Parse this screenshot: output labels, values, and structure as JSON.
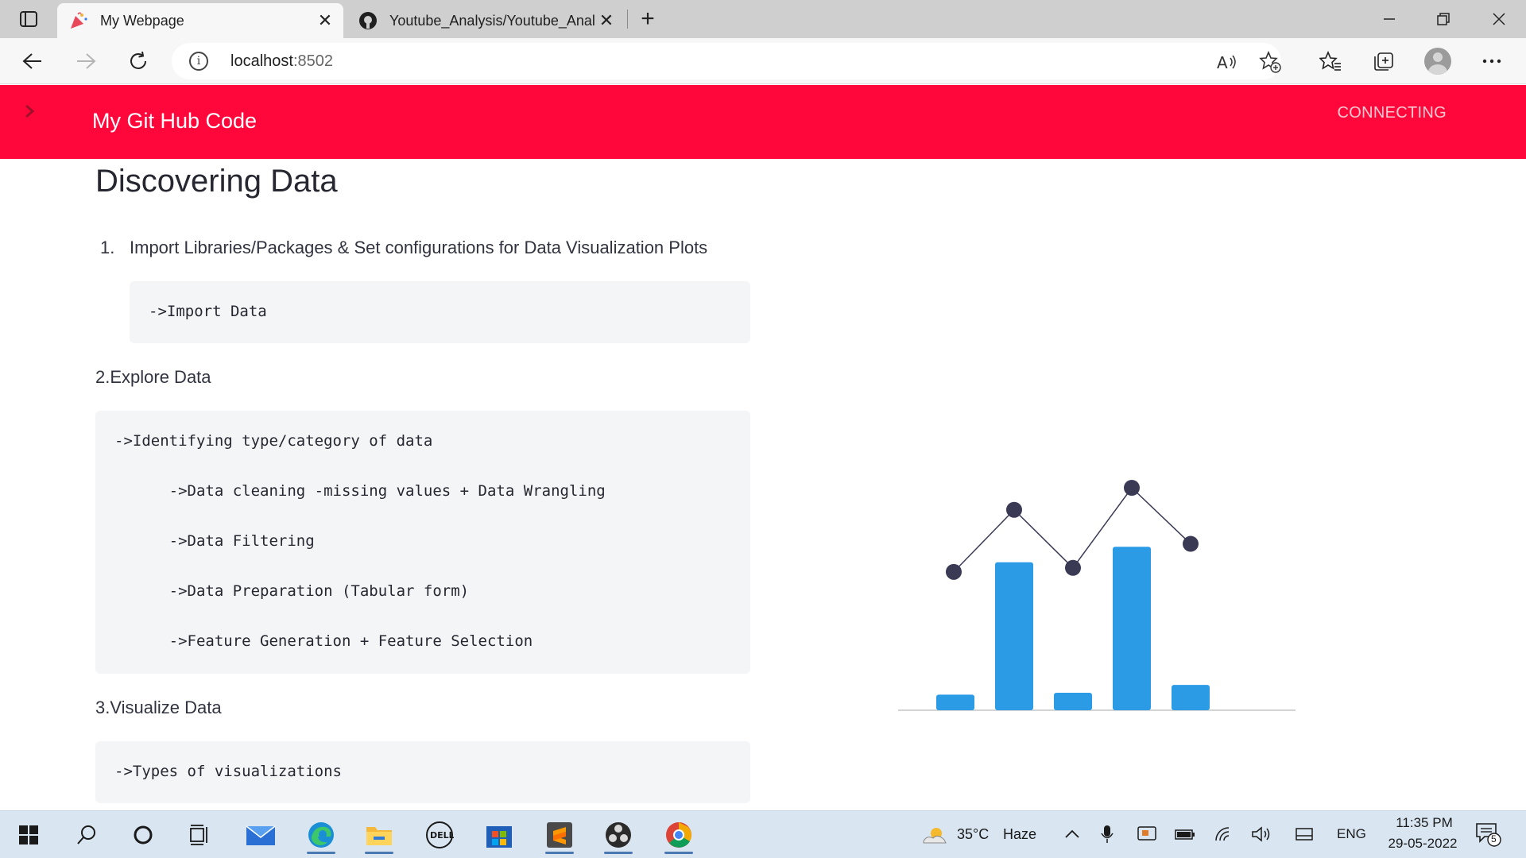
{
  "browser": {
    "tabs": [
      {
        "title": "My Webpage",
        "favicon": "streamlit-party-popper-icon",
        "active": true
      },
      {
        "title": "Youtube_Analysis/Youtube_Analy",
        "favicon": "github-icon",
        "active": false
      }
    ],
    "new_tab_symbol": "+",
    "close_symbol": "✕",
    "address": {
      "host": "localhost",
      "port": ":8502"
    }
  },
  "app": {
    "header_title": "My Git Hub Code",
    "status": "CONNECTING",
    "accent_color": "#ff073a",
    "page_title": "Discovering Data",
    "step1": {
      "number": "1.",
      "text": "Import Libraries/Packages & Set configurations for Data Visualization Plots",
      "code": [
        "->Import Data"
      ]
    },
    "step2": {
      "text": "2.Explore Data",
      "code": [
        "->Identifying type/category of data",
        "      ->Data cleaning -missing values + Data Wrangling",
        "      ->Data Filtering",
        "      ->Data Preparation (Tabular form)",
        "      ->Feature Generation + Feature Selection"
      ]
    },
    "step3": {
      "text": "3.Visualize Data",
      "code": [
        "->Types of visualizations"
      ]
    },
    "illustration": {
      "bar_color": "#2b9be6",
      "line_color": "#3a3a55",
      "bar_levels": [
        0.08,
        0.76,
        0.09,
        0.84,
        0.13
      ],
      "point_levels": [
        0.58,
        0.89,
        0.6,
        1.0,
        0.72
      ]
    }
  },
  "taskbar": {
    "weather": {
      "temp": "35°C",
      "condition": "Haze"
    },
    "language": "ENG",
    "time": "11:35 PM",
    "date": "29-05-2022",
    "notification_count": "5",
    "apps": [
      "start-icon",
      "search-icon",
      "cortana-icon",
      "task-view-icon",
      "mail-icon",
      "edge-icon",
      "file-explorer-icon",
      "dell-icon",
      "store-icon",
      "sublime-text-icon",
      "obs-icon",
      "chrome-icon"
    ]
  }
}
